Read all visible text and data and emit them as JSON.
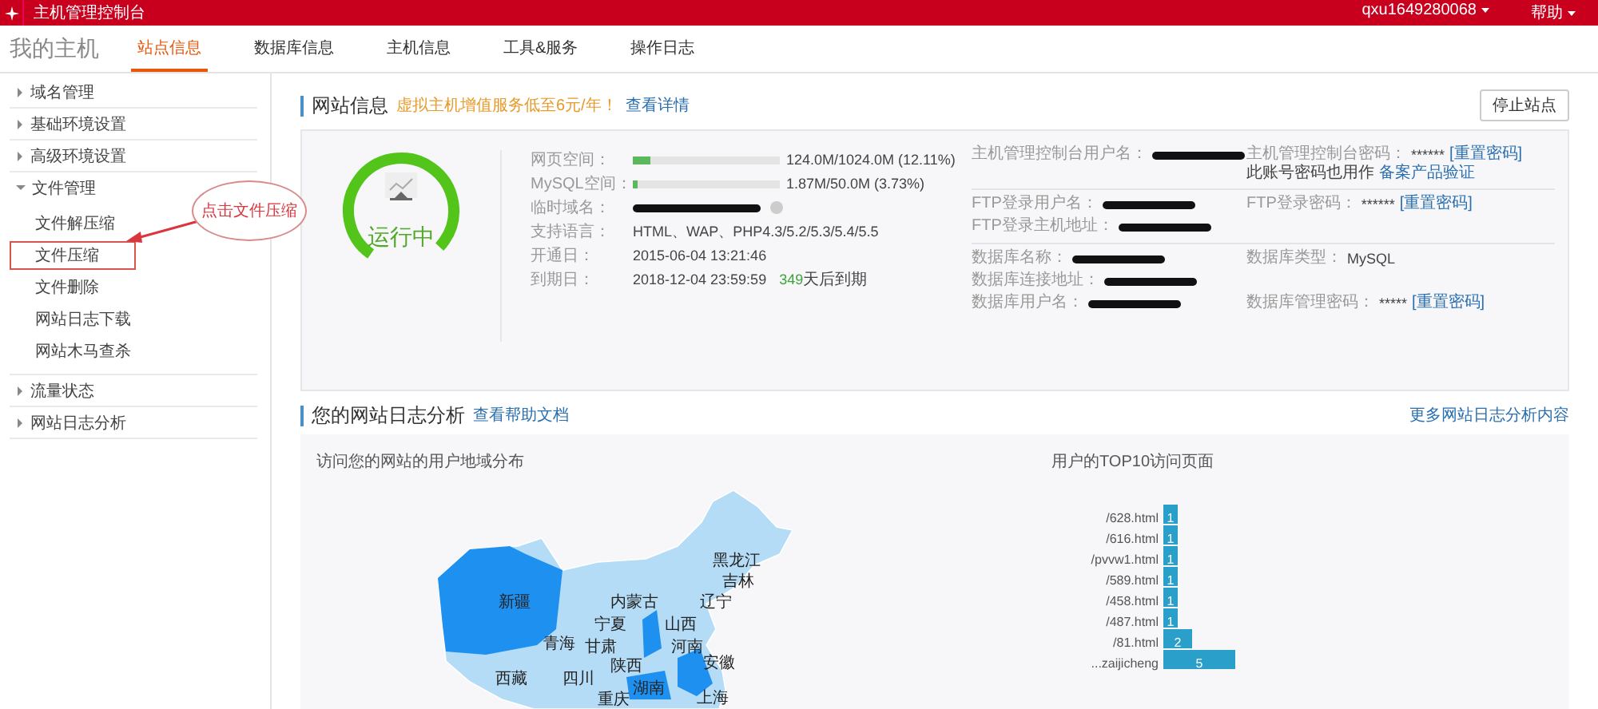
{
  "header": {
    "title": "主机管理控制台",
    "user": "qxu1649280068",
    "help": "帮助"
  },
  "nav": {
    "title": "我的主机",
    "tabs": [
      {
        "label": "站点信息",
        "selected": true
      },
      {
        "label": "数据库信息",
        "selected": false
      },
      {
        "label": "主机信息",
        "selected": false
      },
      {
        "label": "工具&服务",
        "selected": false
      },
      {
        "label": "操作日志",
        "selected": false
      }
    ]
  },
  "sidebar": {
    "items": [
      {
        "label": "域名管理",
        "expanded": false
      },
      {
        "label": "基础环境设置",
        "expanded": false
      },
      {
        "label": "高级环境设置",
        "expanded": false
      },
      {
        "label": "文件管理",
        "expanded": true,
        "children": [
          {
            "label": "文件解压缩",
            "highlighted": false
          },
          {
            "label": "文件压缩",
            "highlighted": true
          },
          {
            "label": "文件删除",
            "highlighted": false
          },
          {
            "label": "网站日志下载",
            "highlighted": false
          },
          {
            "label": "网站木马查杀",
            "highlighted": false
          }
        ]
      },
      {
        "label": "流量状态",
        "expanded": false
      },
      {
        "label": "网站日志分析",
        "expanded": false
      }
    ]
  },
  "annotation": {
    "text": "点击文件压缩"
  },
  "site_info": {
    "title": "网站信息",
    "promo": "虚拟主机增值服务低至6元/年！",
    "promo_link": "查看详情",
    "stop_button": "停止站点",
    "status": "运行中",
    "usage": [
      {
        "label": "网页空间：",
        "level": 0.1211,
        "reading": "124.0M/1024.0M (12.11%)"
      },
      {
        "label": "MySQL空间：",
        "level": 0.0373,
        "reading": "1.87M/50.0M (3.73%)"
      }
    ],
    "details": [
      {
        "kind": "redacted",
        "label": "临时域名："
      },
      {
        "kind": "text",
        "label": "支持语言：",
        "value": "HTML、WAP、PHP4.3/5.2/5.3/5.4/5.5"
      },
      {
        "kind": "text",
        "label": "开通日：",
        "value": "2015-06-04 13:21:46"
      },
      {
        "kind": "expiry",
        "label": "到期日：",
        "value": "2018-12-04 23:59:59",
        "days": "349",
        "days_suffix": "天后到期"
      }
    ],
    "account_groups": [
      [
        [
          {
            "kind": "redacted",
            "label": "主机管理控制台用户名："
          },
          {
            "kind": "password",
            "label": "主机管理控制台密码：",
            "value": "******",
            "link": "[重置密码]",
            "note": "此账号密码也用作",
            "note_link": "备案产品验证"
          }
        ]
      ],
      [
        [
          {
            "kind": "redacted",
            "label": "FTP登录用户名："
          },
          {
            "kind": "password",
            "label": "FTP登录密码：",
            "value": "******",
            "link": "[重置密码]"
          }
        ],
        [
          {
            "kind": "redacted",
            "label": "FTP登录主机地址："
          }
        ]
      ],
      [
        [
          {
            "kind": "redacted",
            "label": "数据库名称："
          },
          {
            "kind": "text",
            "label": "数据库类型：",
            "value": "MySQL"
          }
        ],
        [
          {
            "kind": "redacted",
            "label": "数据库连接地址："
          }
        ],
        [
          {
            "kind": "redacted",
            "label": "数据库用户名："
          },
          {
            "kind": "password",
            "label": "数据库管理密码：",
            "value": "*****",
            "link": "[重置密码]"
          }
        ]
      ]
    ]
  },
  "log_analysis": {
    "title": "您的网站日志分析",
    "help_link": "查看帮助文档",
    "more_link": "更多网站日志分析内容",
    "map": {
      "title": "访问您的网站的用户地域分布",
      "labels": [
        "黑龙江",
        "吉林",
        "新疆",
        "内蒙古",
        "辽宁",
        "宁夏",
        "山西",
        "青海",
        "甘肃",
        "河南",
        "陕西",
        "安徽",
        "西藏",
        "四川",
        "湖南",
        "重庆",
        "上海"
      ]
    },
    "top_pages": {
      "title": "用户的TOP10访问页面",
      "chart_data": {
        "type": "bar",
        "orientation": "horizontal",
        "data_labels": true,
        "categories": [
          "/628.html",
          "/616.html",
          "/pvvw1.html",
          "/589.html",
          "/458.html",
          "/487.html",
          "/81.html",
          "...zaijicheng"
        ],
        "values": [
          1,
          1,
          1,
          1,
          1,
          1,
          2,
          5
        ]
      }
    }
  }
}
